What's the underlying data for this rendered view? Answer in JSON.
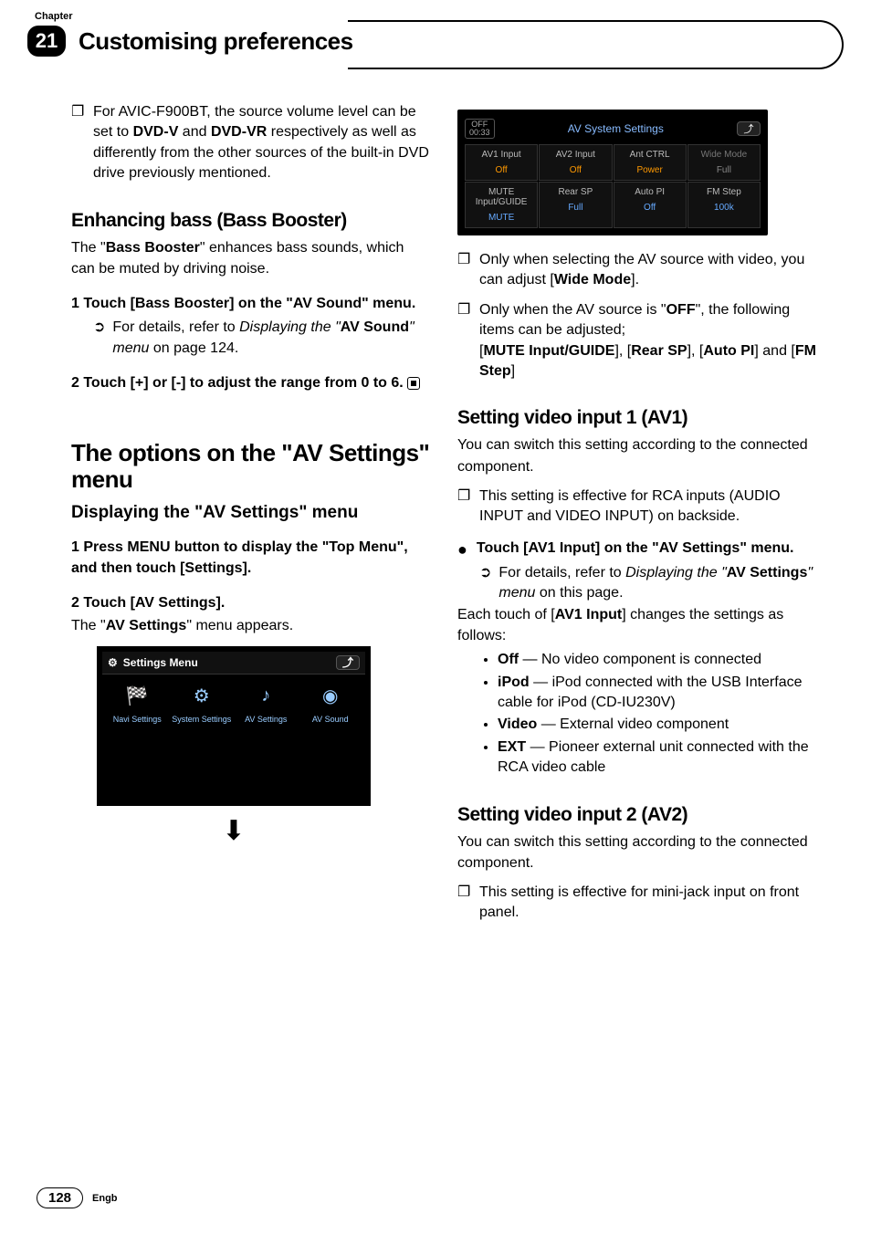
{
  "header": {
    "chapter_label": "Chapter",
    "chapter_number": "21",
    "title": "Customising preferences"
  },
  "col1": {
    "note1_pre": "For AVIC-F900BT, the source volume level can be set to ",
    "note1_b1": "DVD-V",
    "note1_mid": " and ",
    "note1_b2": "DVD-VR",
    "note1_post": " respectively as well as differently from the other sources of the built-in DVD drive previously mentioned.",
    "h2_bass": "Enhancing bass (Bass Booster)",
    "bass_p_pre": "The \"",
    "bass_p_b": "Bass Booster",
    "bass_p_post": "\" enhances bass sounds, which can be muted by driving noise.",
    "step1": "1    Touch [Bass Booster] on the \"AV Sound\" menu.",
    "ref1_pre": "For details, refer to ",
    "ref1_i": "Displaying the \"",
    "ref1_b": "AV Sound",
    "ref1_i2": "\" menu",
    "ref1_post": " on page 124.",
    "step2": "2    Touch [+] or [-] to adjust the range from 0 to 6.",
    "h1_options": "The options on the \"AV Settings\" menu",
    "h3_display": "Displaying the \"AV Settings\" menu",
    "step_menu": "1    Press MENU button to display the \"Top Menu\", and then touch [Settings].",
    "step_av": "2    Touch [AV Settings].",
    "av_appears_pre": "The \"",
    "av_appears_b": "AV Settings",
    "av_appears_post": "\" menu appears.",
    "settings_menu_title": "Settings Menu",
    "sm_items": [
      "Navi Settings",
      "System Settings",
      "AV Settings",
      "AV Sound"
    ]
  },
  "col2": {
    "ss_title": "AV System Settings",
    "off_label": "OFF",
    "off_time": "00:33",
    "grid": {
      "r1": [
        {
          "lbl": "AV1 Input",
          "val": "Off",
          "cls": "orange"
        },
        {
          "lbl": "AV2 Input",
          "val": "Off",
          "cls": "orange"
        },
        {
          "lbl": "Ant CTRL",
          "val": "Power",
          "cls": "orange"
        },
        {
          "lbl": "Wide Mode",
          "val": "Full",
          "cls": "gray"
        }
      ],
      "r2": [
        {
          "lbl": "MUTE Input/GUIDE",
          "val": "MUTE",
          "cls": ""
        },
        {
          "lbl": "Rear SP",
          "val": "Full",
          "cls": ""
        },
        {
          "lbl": "Auto PI",
          "val": "Off",
          "cls": ""
        },
        {
          "lbl": "FM Step",
          "val": "100k",
          "cls": ""
        }
      ]
    },
    "note_wide_pre": "Only when selecting the AV source with video, you can adjust [",
    "note_wide_b": "Wide Mode",
    "note_wide_post": "].",
    "note_off_pre": "Only when the AV source is \"",
    "note_off_b": "OFF",
    "note_off_mid": "\", the following items can be adjusted;",
    "note_off_items_pre": "[",
    "note_off_i1": "MUTE Input/GUIDE",
    "note_off_s1": "], [",
    "note_off_i2": "Rear SP",
    "note_off_s2": "], [",
    "note_off_i3": "Auto PI",
    "note_off_s3": "] and [",
    "note_off_i4": "FM Step",
    "note_off_s4": "]",
    "h2_av1": "Setting video input 1 (AV1)",
    "av1_p": "You can switch this setting according to the connected component.",
    "av1_note": "This setting is effective for RCA inputs (AUDIO INPUT and VIDEO INPUT) on backside.",
    "av1_bullet": "Touch [AV1 Input] on the \"AV Settings\" menu.",
    "av1_ref_pre": "For details, refer to ",
    "av1_ref_i": "Displaying the \"",
    "av1_ref_b": "AV Settings",
    "av1_ref_i2": "\" menu",
    "av1_ref_post": " on this page.",
    "av1_each_pre": "Each touch of [",
    "av1_each_b": "AV1 Input",
    "av1_each_post": "] changes the settings as follows:",
    "opts": {
      "off_b": "Off",
      "off_t": " — No video component is connected",
      "ipod_b": "iPod",
      "ipod_t": " — iPod connected with the USB Interface cable for iPod (CD-IU230V)",
      "video_b": "Video",
      "video_t": " — External video component",
      "ext_b": "EXT",
      "ext_t": " — Pioneer external unit connected with the RCA video cable"
    },
    "h2_av2": "Setting video input 2 (AV2)",
    "av2_p": "You can switch this setting according to the connected component.",
    "av2_note": "This setting is effective for mini-jack input on front panel."
  },
  "footer": {
    "page": "128",
    "lang": "Engb"
  }
}
